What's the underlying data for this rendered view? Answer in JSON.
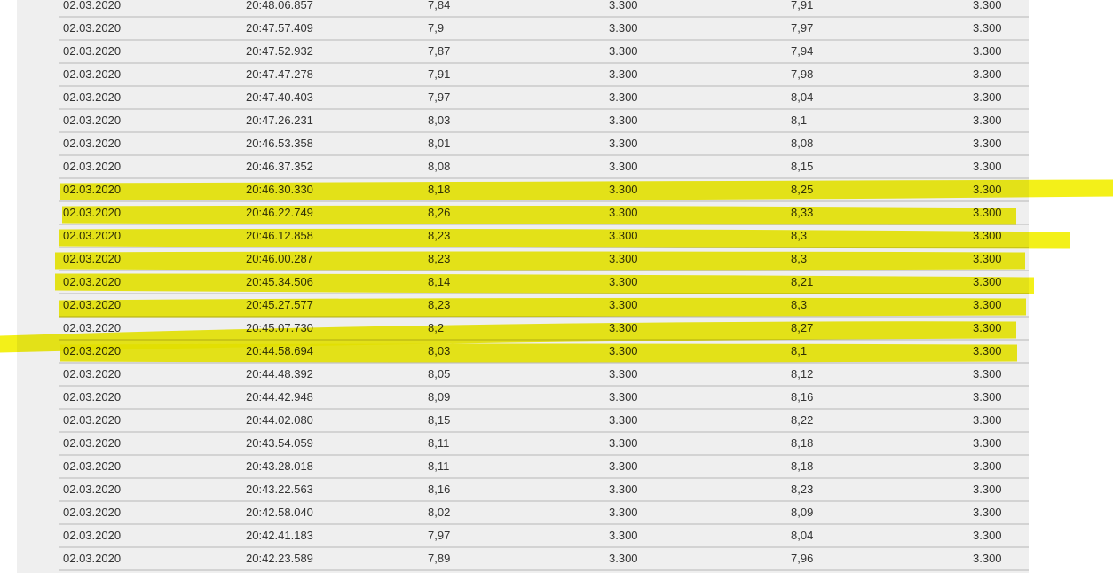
{
  "colors": {
    "panel": "#efefef",
    "row_divider": "#d3d3d3",
    "text": "#333333",
    "highlighter": "#f2ee00"
  },
  "highlighted_rows": [
    8,
    9,
    10,
    11,
    12,
    13,
    14,
    15
  ],
  "rows": [
    [
      "02.03.2020",
      "20:48.06.857",
      "7,84",
      "3.300",
      "7,91",
      "3.300"
    ],
    [
      "02.03.2020",
      "20:47.57.409",
      "7,9",
      "3.300",
      "7,97",
      "3.300"
    ],
    [
      "02.03.2020",
      "20:47.52.932",
      "7,87",
      "3.300",
      "7,94",
      "3.300"
    ],
    [
      "02.03.2020",
      "20:47.47.278",
      "7,91",
      "3.300",
      "7,98",
      "3.300"
    ],
    [
      "02.03.2020",
      "20:47.40.403",
      "7,97",
      "3.300",
      "8,04",
      "3.300"
    ],
    [
      "02.03.2020",
      "20:47.26.231",
      "8,03",
      "3.300",
      "8,1",
      "3.300"
    ],
    [
      "02.03.2020",
      "20:46.53.358",
      "8,01",
      "3.300",
      "8,08",
      "3.300"
    ],
    [
      "02.03.2020",
      "20:46.37.352",
      "8,08",
      "3.300",
      "8,15",
      "3.300"
    ],
    [
      "02.03.2020",
      "20:46.30.330",
      "8,18",
      "3.300",
      "8,25",
      "3.300"
    ],
    [
      "02.03.2020",
      "20:46.22.749",
      "8,26",
      "3.300",
      "8,33",
      "3.300"
    ],
    [
      "02.03.2020",
      "20:46.12.858",
      "8,23",
      "3.300",
      "8,3",
      "3.300"
    ],
    [
      "02.03.2020",
      "20:46.00.287",
      "8,23",
      "3.300",
      "8,3",
      "3.300"
    ],
    [
      "02.03.2020",
      "20:45.34.506",
      "8,14",
      "3.300",
      "8,21",
      "3.300"
    ],
    [
      "02.03.2020",
      "20:45.27.577",
      "8,23",
      "3.300",
      "8,3",
      "3.300"
    ],
    [
      "02.03.2020",
      "20:45.07.730",
      "8,2",
      "3.300",
      "8,27",
      "3.300"
    ],
    [
      "02.03.2020",
      "20:44.58.694",
      "8,03",
      "3.300",
      "8,1",
      "3.300"
    ],
    [
      "02.03.2020",
      "20:44.48.392",
      "8,05",
      "3.300",
      "8,12",
      "3.300"
    ],
    [
      "02.03.2020",
      "20:44.42.948",
      "8,09",
      "3.300",
      "8,16",
      "3.300"
    ],
    [
      "02.03.2020",
      "20:44.02.080",
      "8,15",
      "3.300",
      "8,22",
      "3.300"
    ],
    [
      "02.03.2020",
      "20:43.54.059",
      "8,11",
      "3.300",
      "8,18",
      "3.300"
    ],
    [
      "02.03.2020",
      "20:43.28.018",
      "8,11",
      "3.300",
      "8,18",
      "3.300"
    ],
    [
      "02.03.2020",
      "20:43.22.563",
      "8,16",
      "3.300",
      "8,23",
      "3.300"
    ],
    [
      "02.03.2020",
      "20:42.58.040",
      "8,02",
      "3.300",
      "8,09",
      "3.300"
    ],
    [
      "02.03.2020",
      "20:42.41.183",
      "7,97",
      "3.300",
      "8,04",
      "3.300"
    ],
    [
      "02.03.2020",
      "20:42.23.589",
      "7,89",
      "3.300",
      "7,96",
      "3.300"
    ]
  ]
}
